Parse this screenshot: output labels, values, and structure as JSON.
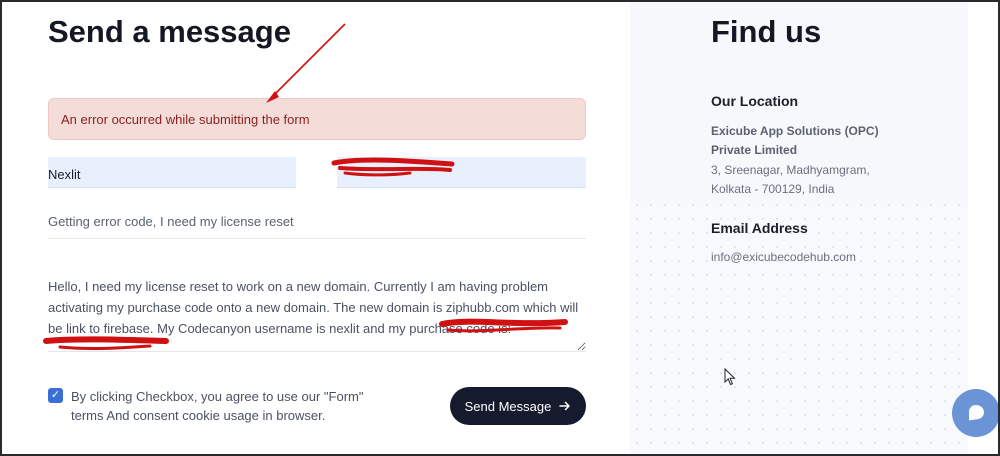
{
  "contact": {
    "title": "Send a message",
    "error": "An error occurred while submitting the form",
    "name_value": "Nexlit",
    "email_value": "",
    "subject_value": "Getting error code, I need my license reset",
    "message_value": "Hello, I need my license reset to work on a new domain. Currently I am having problem activating my purchase code onto a new domain. The new domain is ziphubb.com which will be link to firebase. My Codecanyon username is nexlit and my purchase code is:",
    "consent_text": "By clicking Checkbox, you agree to use our \"Form\" terms And consent cookie usage in browser.",
    "checkbox_checked": true,
    "send_label": "Send Message",
    "send_icon": "arrow-right-icon"
  },
  "info": {
    "title": "Find us",
    "location_heading": "Our Location",
    "company_line1": "Exicube App Solutions (OPC)",
    "company_line2": "Private Limited",
    "address_line1": "3, Sreenagar, Madhyamgram,",
    "address_line2": "Kolkata - 700129, India",
    "email_heading": "Email Address",
    "email": "info@exicubecodehub.com"
  },
  "colors": {
    "error_bg": "#f4ddd9",
    "error_text": "#8a1f1f",
    "button_bg": "#151a2d",
    "checkbox": "#3b6fd8",
    "chat_bubble": "#6b94d6",
    "annotation_red": "#d11111"
  }
}
